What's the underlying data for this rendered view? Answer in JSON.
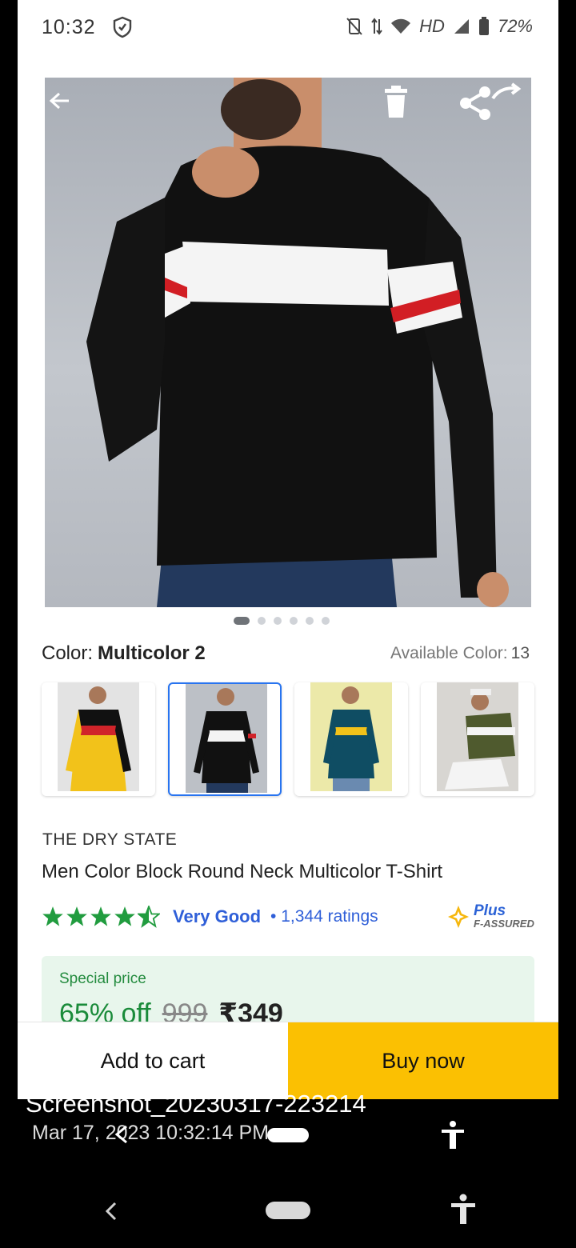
{
  "status_bar": {
    "time": "10:32",
    "network_label": "HD",
    "battery": "72%"
  },
  "product": {
    "color_label": "Color:",
    "color_value": "Multicolor 2",
    "available_label": "Available Color:",
    "available_count": "13",
    "brand": "THE DRY STATE",
    "title": "Men Color Block Round Neck Multicolor T-Shirt",
    "rating_stars": 4.5,
    "rating_text": "Very Good",
    "rating_count": "• 1,344 ratings",
    "plus_badge": {
      "word": "Plus",
      "sub": "F-ASSURED"
    },
    "images_total": 6,
    "image_index": 1
  },
  "swatches": [
    {
      "name": "Yellow / Red / Black",
      "selected": false
    },
    {
      "name": "Black / White / Red",
      "selected": true
    },
    {
      "name": "Teal / Yellow",
      "selected": false
    },
    {
      "name": "Olive / White",
      "selected": false
    }
  ],
  "price": {
    "special_label": "Special price",
    "discount": "65% off",
    "mrp": "999",
    "final": "₹349"
  },
  "actions": {
    "add_to_cart": "Add to cart",
    "buy_now": "Buy now"
  },
  "screenshot_caption": {
    "filename": "Screenshot_20230317-223214",
    "date": "Mar 17, 2023 10:32:14 PM"
  },
  "colors": {
    "buy_now_bg": "#fbc002",
    "accent_blue": "#2874f0",
    "discount_green": "#1a8b3a",
    "price_box_bg": "#e8f6ec"
  }
}
